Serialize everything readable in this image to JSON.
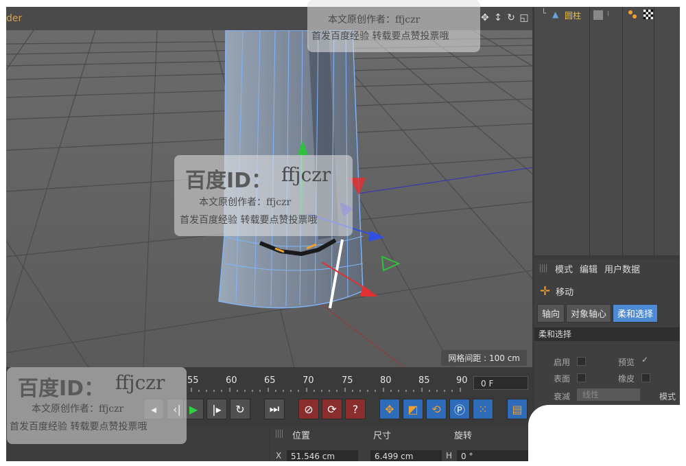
{
  "viewport": {
    "title": "der",
    "grid_spacing": "网格间距 : 100 cm",
    "nav_icons": [
      "move-view-icon",
      "zoom-view-icon",
      "rotate-view-icon",
      "maximize-view-icon"
    ]
  },
  "object_manager": {
    "object_name": "圆柱"
  },
  "attributes": {
    "tabs": [
      "模式",
      "编辑",
      "用户数据"
    ],
    "tool_name": "移动",
    "mode_buttons": [
      "轴向",
      "对象轴心",
      "柔和选择"
    ],
    "section_title": "柔和选择",
    "enable_label": "启用",
    "preview_label": "预览",
    "surface_label": "表面",
    "rubber_label": "橡皮",
    "falloff_label": "衰减",
    "falloff_value": "线性",
    "mode_label": "模式"
  },
  "timeline": {
    "ticks": [
      "55",
      "60",
      "65",
      "70",
      "75",
      "80",
      "85",
      "90"
    ],
    "frame_value": "0 F",
    "left_tick": "90"
  },
  "coordinates": {
    "position_header": "位置",
    "size_header": "尺寸",
    "rotation_header": "旋转",
    "x_label": "X",
    "x_value": "51.546 cm",
    "size_x_value": "6.499 cm",
    "h_label": "H",
    "h_value": "0 °"
  },
  "watermarks": {
    "top_small_1": "本文原创作者：ffjczr",
    "top_small_2": "首发百度经验  转载要点赞投票哦",
    "center_big": "百度ID：",
    "center_id": "ffjczr",
    "center_small_1": "本文原创作者：ffjczr",
    "center_small_2": "首发百度经验  转载要点赞投票哦",
    "bottom_big": "百度ID：",
    "bottom_id": "ffjczr",
    "bottom_small_1": "本文原创作者：ffjczr",
    "bottom_small_2": "首发百度经验  转载要点赞投票哦"
  },
  "colors": {
    "x_axis": "#e03030",
    "y_axis": "#30c040",
    "z_axis": "#3050e0",
    "selection": "#4d8ad6",
    "accent": "#f0a030"
  }
}
